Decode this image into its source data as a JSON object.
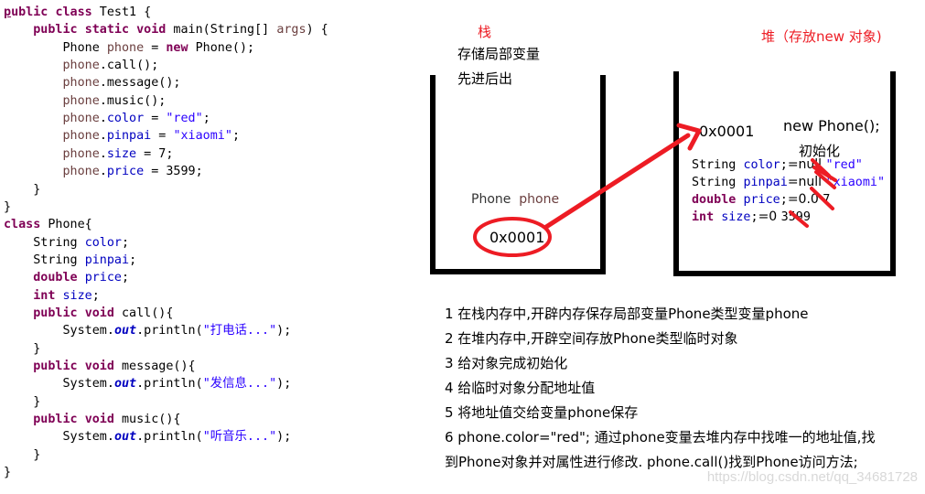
{
  "code": {
    "lines": [
      [
        {
          "t": "public",
          "c": "kw ul-first"
        },
        {
          "t": " "
        },
        {
          "t": "class",
          "c": "kw"
        },
        {
          "t": " Test1 {"
        }
      ],
      [
        {
          "t": "    "
        },
        {
          "t": "public",
          "c": "kw"
        },
        {
          "t": " "
        },
        {
          "t": "static",
          "c": "kw"
        },
        {
          "t": " "
        },
        {
          "t": "void",
          "c": "kw"
        },
        {
          "t": " main(String[] "
        },
        {
          "t": "args",
          "c": "loc"
        },
        {
          "t": ") {"
        }
      ],
      [
        {
          "t": "        Phone "
        },
        {
          "t": "phone",
          "c": "loc"
        },
        {
          "t": " = "
        },
        {
          "t": "new",
          "c": "kw"
        },
        {
          "t": " Phone();"
        }
      ],
      [
        {
          "t": "        "
        },
        {
          "t": "phone",
          "c": "loc"
        },
        {
          "t": ".call();"
        }
      ],
      [
        {
          "t": "        "
        },
        {
          "t": "phone",
          "c": "loc"
        },
        {
          "t": ".message();"
        }
      ],
      [
        {
          "t": "        "
        },
        {
          "t": "phone",
          "c": "loc"
        },
        {
          "t": ".music();"
        }
      ],
      [
        {
          "t": "        "
        },
        {
          "t": "phone",
          "c": "loc"
        },
        {
          "t": "."
        },
        {
          "t": "color",
          "c": "fld"
        },
        {
          "t": " = "
        },
        {
          "t": "\"red\"",
          "c": "str"
        },
        {
          "t": ";"
        }
      ],
      [
        {
          "t": "        "
        },
        {
          "t": "phone",
          "c": "loc"
        },
        {
          "t": "."
        },
        {
          "t": "pinpai",
          "c": "fld"
        },
        {
          "t": " = "
        },
        {
          "t": "\"xiaomi\"",
          "c": "str"
        },
        {
          "t": ";"
        }
      ],
      [
        {
          "t": "        "
        },
        {
          "t": "phone",
          "c": "loc"
        },
        {
          "t": "."
        },
        {
          "t": "size",
          "c": "fld"
        },
        {
          "t": " = 7;"
        }
      ],
      [
        {
          "t": "        "
        },
        {
          "t": "phone",
          "c": "loc"
        },
        {
          "t": "."
        },
        {
          "t": "price",
          "c": "fld"
        },
        {
          "t": " = 3599;"
        }
      ],
      [
        {
          "t": "    }"
        }
      ],
      [
        {
          "t": "}"
        }
      ],
      [
        {
          "t": "class",
          "c": "kw"
        },
        {
          "t": " Phone{"
        }
      ],
      [
        {
          "t": "    String "
        },
        {
          "t": "color",
          "c": "fld"
        },
        {
          "t": ";"
        }
      ],
      [
        {
          "t": "    String "
        },
        {
          "t": "pinpai",
          "c": "fld"
        },
        {
          "t": ";"
        }
      ],
      [
        {
          "t": "    "
        },
        {
          "t": "double",
          "c": "kw"
        },
        {
          "t": " "
        },
        {
          "t": "price",
          "c": "fld"
        },
        {
          "t": ";"
        }
      ],
      [
        {
          "t": "    "
        },
        {
          "t": "int",
          "c": "kw"
        },
        {
          "t": " "
        },
        {
          "t": "size",
          "c": "fld"
        },
        {
          "t": ";"
        }
      ],
      [
        {
          "t": "    "
        },
        {
          "t": "public",
          "c": "kw"
        },
        {
          "t": " "
        },
        {
          "t": "void",
          "c": "kw"
        },
        {
          "t": " call(){"
        }
      ],
      [
        {
          "t": "        System."
        },
        {
          "t": "out",
          "c": "static-fld"
        },
        {
          "t": ".println("
        },
        {
          "t": "\"打电话...\"",
          "c": "str"
        },
        {
          "t": ");"
        }
      ],
      [
        {
          "t": "    }"
        }
      ],
      [
        {
          "t": "    "
        },
        {
          "t": "public",
          "c": "kw"
        },
        {
          "t": " "
        },
        {
          "t": "void",
          "c": "kw"
        },
        {
          "t": " message(){"
        }
      ],
      [
        {
          "t": "        System."
        },
        {
          "t": "out",
          "c": "static-fld"
        },
        {
          "t": ".println("
        },
        {
          "t": "\"发信息...\"",
          "c": "str"
        },
        {
          "t": ");"
        }
      ],
      [
        {
          "t": "    }"
        }
      ],
      [
        {
          "t": "    "
        },
        {
          "t": "public",
          "c": "kw"
        },
        {
          "t": " "
        },
        {
          "t": "void",
          "c": "kw"
        },
        {
          "t": " music(){"
        }
      ],
      [
        {
          "t": "        System."
        },
        {
          "t": "out",
          "c": "static-fld"
        },
        {
          "t": ".println("
        },
        {
          "t": "\"听音乐...\"",
          "c": "str"
        },
        {
          "t": ");"
        }
      ],
      [
        {
          "t": "    }"
        }
      ],
      [
        {
          "t": "}"
        }
      ]
    ]
  },
  "stack": {
    "title": "栈",
    "desc1": "存储局部变量",
    "desc2": "先进后出",
    "var_type": "Phone",
    "var_name": "phone",
    "address": "0x0001"
  },
  "heap": {
    "title": "堆（存放new 对象)",
    "address": "0x0001",
    "new_expr": "new Phone();",
    "init_label": "初始化",
    "fields": [
      {
        "type": "String",
        "type_kw": false,
        "name": "color",
        "sep": ";",
        "default": "=null",
        "value": "\"red\"",
        "value_is_string": true
      },
      {
        "type": "String",
        "type_kw": false,
        "name": "pinpai",
        "sep": "",
        "default": "=null",
        "value": "\"xiaomi\"",
        "value_is_string": true
      },
      {
        "type": "double",
        "type_kw": true,
        "name": "price",
        "sep": ";",
        "default": "=0.0",
        "value": "7",
        "value_is_string": false
      },
      {
        "type": "int",
        "type_kw": true,
        "name": "size",
        "sep": ";",
        "default": "=0",
        "value": "3599",
        "value_is_string": false
      }
    ]
  },
  "steps": [
    "1 在栈内存中,开辟内存保存局部变量Phone类型变量phone",
    "2  在堆内存中,开辟空间存放Phone类型临时对象",
    "3  给对象完成初始化",
    "4  给临时对象分配地址值",
    "5  将地址值交给变量phone保存",
    "6  phone.color=\"red\"; 通过phone变量去堆内存中找唯一的地址值,找",
    "到Phone对象并对属性进行修改. phone.call()找到Phone访问方法;"
  ],
  "watermark": "https://blog.csdn.net/qq_34681728",
  "colors": {
    "annotation_red": "#ed1c24",
    "keyword": "#7f0055",
    "field": "#0000c0",
    "string": "#2a00ff",
    "local_var": "#6a3e3e"
  }
}
